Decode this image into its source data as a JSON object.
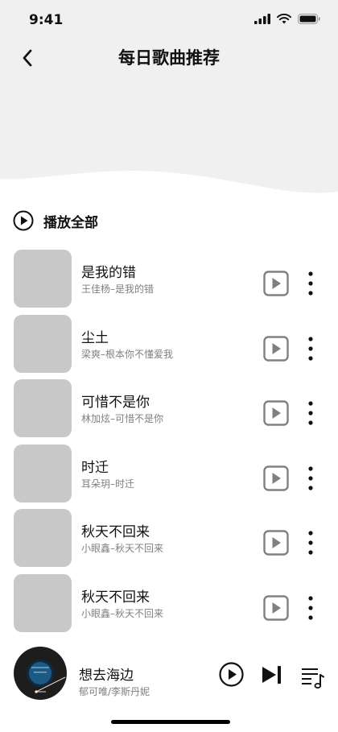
{
  "status_bar": {
    "time": "9:41"
  },
  "header": {
    "title": "每日歌曲推荐"
  },
  "play_all": {
    "label": "播放全部"
  },
  "songs": [
    {
      "title": "是我的错",
      "subtitle": "王佳杨–是我的错"
    },
    {
      "title": "尘土",
      "subtitle": "梁爽–根本你不懂爱我"
    },
    {
      "title": "可惜不是你",
      "subtitle": "林加炫–可惜不是你"
    },
    {
      "title": "时迁",
      "subtitle": "耳朵玥–时迁"
    },
    {
      "title": "秋天不回来",
      "subtitle": "小眼鑫–秋天不回来"
    },
    {
      "title": "秋天不回来",
      "subtitle": "小眼鑫–秋天不回来"
    }
  ],
  "player": {
    "title": "想去海边",
    "artist": "郁可唯/李斯丹妮"
  },
  "colors": {
    "header_bg": "#f0f0f0",
    "cover_placeholder": "#c8c8c8",
    "icon_gray": "#808080",
    "subtitle": "#7f7f7f"
  }
}
